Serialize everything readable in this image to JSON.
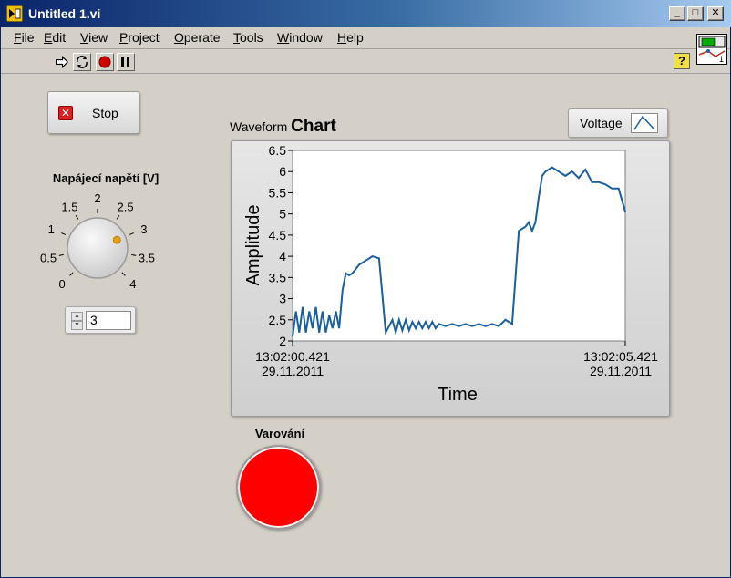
{
  "window": {
    "title": "Untitled 1.vi",
    "controls": {
      "minimize": "_",
      "maximize": "□",
      "close": "✕"
    }
  },
  "menu": {
    "items": [
      {
        "label": "File"
      },
      {
        "label": "Edit"
      },
      {
        "label": "View"
      },
      {
        "label": "Project"
      },
      {
        "label": "Operate"
      },
      {
        "label": "Tools"
      },
      {
        "label": "Window"
      },
      {
        "label": "Help"
      }
    ]
  },
  "toolbar": {
    "icons": [
      "run-arrow-icon",
      "run-continuously-icon",
      "abort-icon",
      "pause-icon"
    ],
    "help_label": "?",
    "vi_icon_number": "1"
  },
  "stop_button": {
    "label": "Stop"
  },
  "knob": {
    "label": "Napájecí napětí [V]",
    "value": 3,
    "min": 0,
    "max": 4,
    "ticks": [
      "0",
      "0.5",
      "1",
      "1.5",
      "2",
      "2.5",
      "3",
      "3.5",
      "4"
    ],
    "indicator_color": "#e8a000"
  },
  "numeric": {
    "value": "3"
  },
  "chart": {
    "title_prefix": "Waveform",
    "title_main": "Chart",
    "legend": {
      "series_name": "Voltage",
      "color": "#1a5fa0"
    }
  },
  "chart_data": {
    "type": "line",
    "title": "Waveform Chart",
    "xlabel": "Time",
    "ylabel": "Amplitude",
    "ylim": [
      2,
      6.5
    ],
    "y_ticks": [
      "2",
      "2.5",
      "3",
      "3.5",
      "4",
      "4.5",
      "5",
      "5.5",
      "6",
      "6.5"
    ],
    "x_ticks": [
      {
        "time": "13:02:00.421",
        "date": "29.11.2011"
      },
      {
        "time": "13:02:05.421",
        "date": "29.11.2011"
      }
    ],
    "x_range": [
      0,
      5
    ],
    "series": [
      {
        "name": "Voltage",
        "color": "#1a5fa0",
        "x": [
          0.0,
          0.05,
          0.1,
          0.15,
          0.2,
          0.25,
          0.3,
          0.35,
          0.4,
          0.45,
          0.5,
          0.55,
          0.6,
          0.65,
          0.7,
          0.75,
          0.8,
          0.85,
          0.9,
          1.0,
          1.1,
          1.2,
          1.3,
          1.4,
          1.5,
          1.55,
          1.6,
          1.65,
          1.7,
          1.75,
          1.8,
          1.85,
          1.9,
          1.95,
          2.0,
          2.05,
          2.1,
          2.15,
          2.2,
          2.3,
          2.4,
          2.5,
          2.6,
          2.7,
          2.8,
          2.9,
          3.0,
          3.1,
          3.2,
          3.3,
          3.4,
          3.5,
          3.55,
          3.6,
          3.65,
          3.7,
          3.75,
          3.8,
          3.9,
          4.0,
          4.1,
          4.2,
          4.3,
          4.4,
          4.5,
          4.6,
          4.7,
          4.8,
          4.9,
          5.0
        ],
        "values": [
          2.1,
          2.7,
          2.2,
          2.8,
          2.2,
          2.7,
          2.3,
          2.8,
          2.2,
          2.7,
          2.2,
          2.6,
          2.3,
          2.7,
          2.3,
          3.2,
          3.6,
          3.55,
          3.6,
          3.8,
          3.9,
          4.0,
          3.95,
          2.2,
          2.5,
          2.2,
          2.5,
          2.25,
          2.5,
          2.25,
          2.45,
          2.3,
          2.45,
          2.3,
          2.45,
          2.3,
          2.45,
          2.3,
          2.4,
          2.35,
          2.4,
          2.35,
          2.4,
          2.35,
          2.4,
          2.35,
          2.4,
          2.35,
          2.5,
          2.4,
          4.6,
          4.7,
          4.8,
          4.6,
          4.8,
          5.4,
          5.9,
          6.0,
          6.1,
          6.0,
          5.9,
          6.0,
          5.85,
          6.05,
          5.75,
          5.75,
          5.7,
          5.6,
          5.6,
          5.05
        ]
      }
    ],
    "grid": false,
    "legend_position": "top-right"
  },
  "led": {
    "label": "Varování",
    "color": "#ff0000"
  }
}
